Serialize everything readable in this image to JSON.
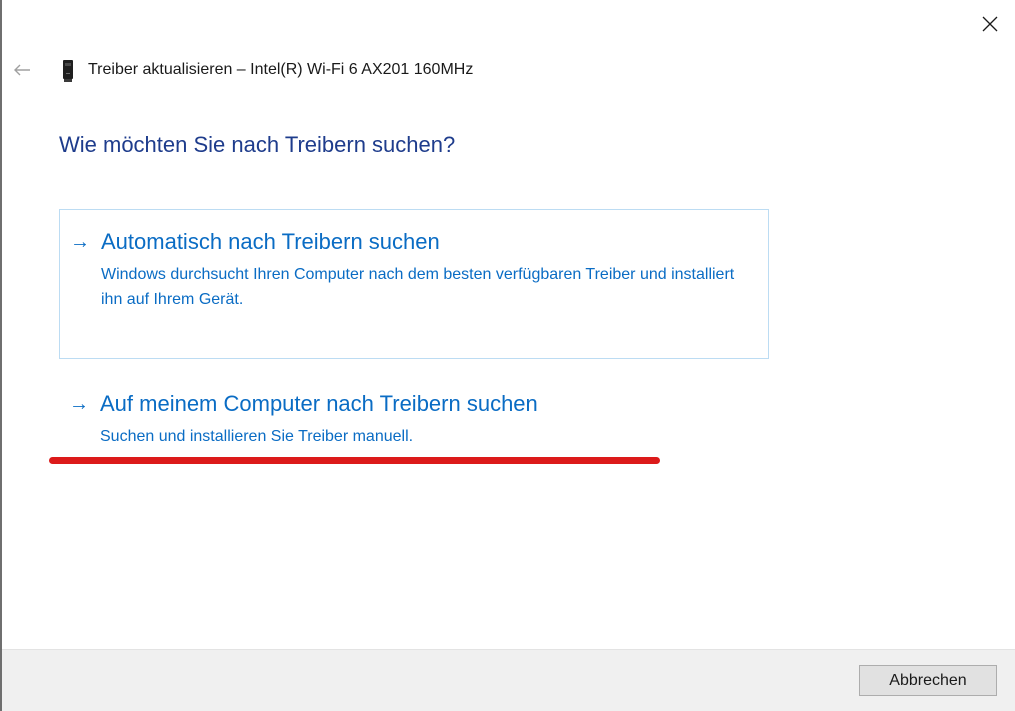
{
  "window": {
    "title": "Treiber aktualisieren – Intel(R) Wi-Fi 6 AX201 160MHz",
    "back_icon": "back-arrow-icon",
    "close_icon": "close-icon",
    "device_icon": "network-adapter-icon"
  },
  "main": {
    "heading": "Wie möchten Sie nach Treibern suchen?",
    "options": [
      {
        "arrow": "→",
        "title": "Automatisch nach Treibern suchen",
        "description": "Windows durchsucht Ihren Computer nach dem besten verfügbaren Treiber und installiert ihn auf Ihrem Gerät."
      },
      {
        "arrow": "→",
        "title": "Auf meinem Computer nach Treibern suchen",
        "description": "Suchen und installieren Sie Treiber manuell."
      }
    ]
  },
  "footer": {
    "cancel_label": "Abbrechen"
  },
  "colors": {
    "heading": "#1e3c8c",
    "link": "#0a6cc4",
    "annotation": "#dc1a1a",
    "option_border": "#bcdcf3"
  }
}
